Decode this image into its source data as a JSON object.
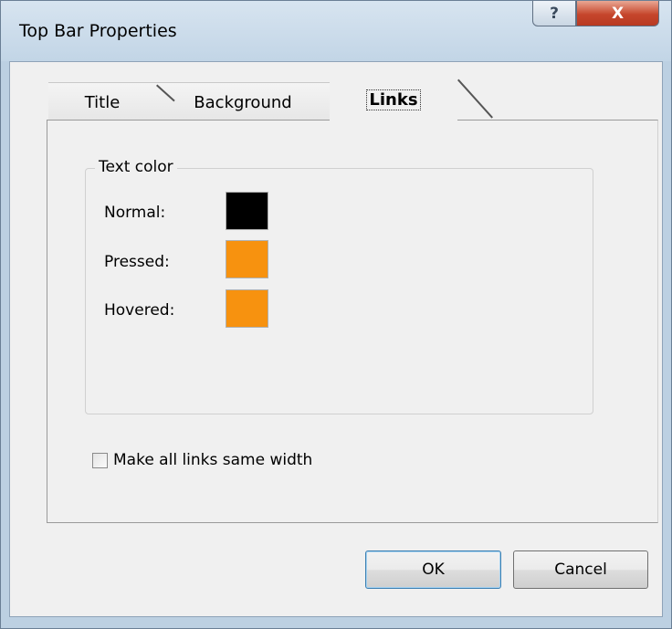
{
  "window": {
    "title": "Top Bar Properties",
    "help_glyph": "?",
    "close_glyph": "X"
  },
  "tabs": [
    {
      "label": "Title",
      "active": false
    },
    {
      "label": "Background",
      "active": false
    },
    {
      "label": "Links",
      "active": true
    }
  ],
  "text_color_group": {
    "legend": "Text color",
    "rows": [
      {
        "label": "Normal:",
        "color": "#000000"
      },
      {
        "label": "Pressed:",
        "color": "#f7920f"
      },
      {
        "label": "Hovered:",
        "color": "#f7920f"
      }
    ]
  },
  "same_width_checkbox": {
    "label": "Make all links same width",
    "checked": false
  },
  "buttons": {
    "ok": "OK",
    "cancel": "Cancel"
  }
}
